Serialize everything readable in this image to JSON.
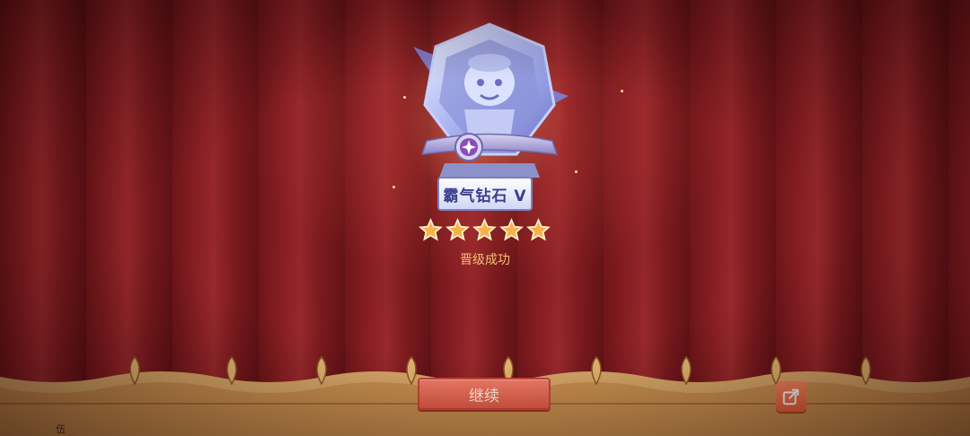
{
  "rank": {
    "name": "霸气钻石 V",
    "stars_filled": 5,
    "stars_total": 5
  },
  "status_text": "晋级成功",
  "buttons": {
    "continue_label": "继续"
  },
  "icons": {
    "share": "share-icon",
    "star": "star-icon",
    "trophy": "trophy-icon"
  },
  "corner_text": "伍",
  "colors": {
    "curtain": "#8b2025",
    "accent_orange": "#e55d4a",
    "star_gold": "#f4c276",
    "rank_text": "#3b3f8f"
  }
}
